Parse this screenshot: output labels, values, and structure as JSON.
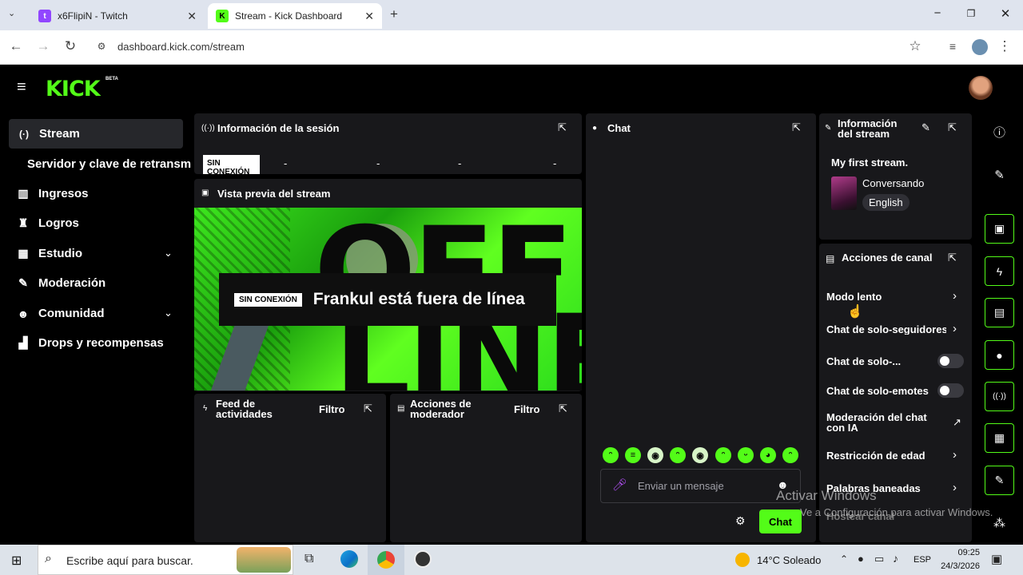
{
  "browser": {
    "tabs": [
      {
        "title": "x6FlipiN - Twitch",
        "color": "#9146ff"
      },
      {
        "title": "Stream - Kick Dashboard",
        "color": "#53fc18"
      }
    ],
    "url": "dashboard.kick.com/stream"
  },
  "header": {
    "logo": "KICK",
    "beta": "BETA"
  },
  "sidebar": {
    "items": [
      {
        "label": "Stream",
        "icon": "radio-icon"
      },
      {
        "label": "Servidor y clave de retransm",
        "icon": ""
      },
      {
        "label": "Ingresos",
        "icon": "chart-icon"
      },
      {
        "label": "Logros",
        "icon": "trophy-icon"
      },
      {
        "label": "Estudio",
        "icon": "studio-icon"
      },
      {
        "label": "Moderación",
        "icon": "wrench-icon"
      },
      {
        "label": "Comunidad",
        "icon": "community-icon"
      },
      {
        "label": "Drops y recompensas",
        "icon": "drops-icon"
      }
    ]
  },
  "session": {
    "title": "Información de la sesión",
    "badge": "SIN CONEXIÓN",
    "stats": [
      "-",
      "-",
      "-",
      "-"
    ]
  },
  "preview": {
    "title": "Vista previa del stream",
    "bg_letters_top": "OFF",
    "bg_letters_bottom": "LINE",
    "badge": "SIN CONEXIÓN",
    "message": "Frankul está fuera de línea"
  },
  "feed": {
    "title_line1": "Feed de",
    "title_line2": "actividades",
    "filter": "Filtro"
  },
  "modactions": {
    "title_line1": "Acciones de",
    "title_line2": "moderador",
    "filter": "Filtro"
  },
  "chat": {
    "title": "Chat",
    "placeholder": "Enviar un mensaje",
    "send_label": "Chat",
    "emotes": [
      "ᵔ",
      "≡",
      "◉",
      "ᵔ",
      "◉",
      "ᵔ",
      "ᵕ",
      "◕",
      "ᵔ"
    ]
  },
  "stream_info": {
    "title_line1": "Información",
    "title_line2": "del stream",
    "stream_title": "My first stream.",
    "category": "Conversando",
    "language": "English"
  },
  "channel_actions": {
    "title": "Acciones de canal",
    "items": [
      {
        "label": "Modo lento",
        "control": "chevron"
      },
      {
        "label": "Chat de solo-seguidores",
        "control": "chevron"
      },
      {
        "label": "Chat de solo-...",
        "control": "toggle"
      },
      {
        "label": "Chat de solo-emotes",
        "control": "toggle"
      },
      {
        "label": "Moderación del chat con IA",
        "control": "external"
      },
      {
        "label": "Restricción de edad",
        "control": "chevron"
      },
      {
        "label": "Palabras baneadas",
        "control": "chevron"
      },
      {
        "label": "Hostear canal",
        "control": "none"
      }
    ]
  },
  "watermark": {
    "line1": "Activar Windows",
    "line2": "Ve a Configuración para activar Windows."
  },
  "taskbar": {
    "search_placeholder": "Escribe aquí para buscar.",
    "weather": "14°C  Soleado",
    "lang": "ESP",
    "time": "09:25",
    "date": "24/3/2026"
  },
  "colors": {
    "accent": "#53fc18",
    "panel": "#18181b",
    "background": "#000000"
  }
}
